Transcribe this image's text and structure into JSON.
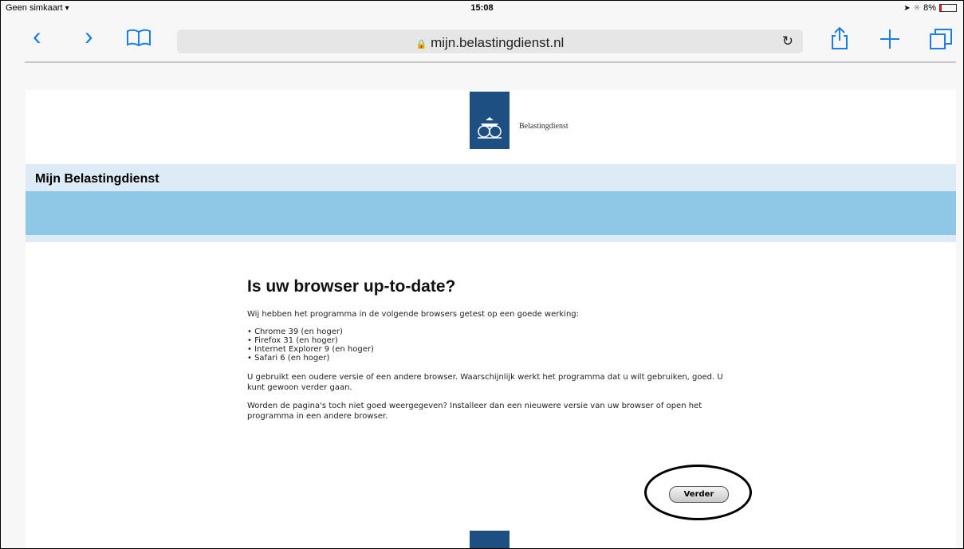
{
  "status_bar": {
    "carrier": "Geen simkaart",
    "time": "15:08",
    "battery": "8%",
    "battery_color": "#e02020"
  },
  "browser": {
    "url": "mijn.belastingdienst.nl",
    "accent_color": "#1a7ee6",
    "icons": [
      "back-icon",
      "forward-icon",
      "bookmarks-icon",
      "lock-icon",
      "reload-icon",
      "share-icon",
      "new-tab-icon",
      "tabs-icon"
    ]
  },
  "page": {
    "logo_text": "Belastingdienst",
    "section_title": "Mijn Belastingdienst",
    "heading": "Is uw browser up-to-date?",
    "intro": "Wij hebben het programma in de volgende browsers getest op een goede werking:",
    "browsers": [
      "Chrome 39 (en hoger)",
      "Firefox 31 (en hoger)",
      "Internet Explorer 9 (en hoger)",
      "Safari 6 (en hoger)"
    ],
    "para1": "U gebruikt een oudere versie of een andere browser. Waarschijnlijk werkt het programma dat u wilt gebruiken, goed. U kunt gewoon verder gaan.",
    "para2": "Worden de pagina's toch niet goed weergegeven? Installeer dan een nieuwere versie van uw browser of open het programma in een andere browser.",
    "button_label": "Verder",
    "brand_color": "#1d4f82"
  }
}
